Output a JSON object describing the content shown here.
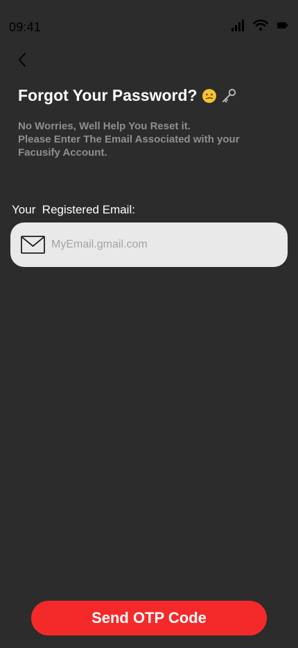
{
  "status_bar": {
    "time": "09:41",
    "icons": [
      "signal-icon",
      "wifi-icon",
      "battery-icon"
    ]
  },
  "header": {
    "back_icon": "chevron-left-icon",
    "title": "Forgot Your Password?",
    "title_emojis": [
      "confused-face-emoji",
      "key-emoji"
    ]
  },
  "subtitle": {
    "line1": "No Worries, Well Help You Reset it.",
    "line2": "Please Enter The Email Associated with your",
    "line3": "Facusify Account."
  },
  "form": {
    "email_label": "Your  Registered Email:",
    "email_icon": "mail-icon",
    "email_value": "",
    "email_placeholder": "MyEmail.gmail.com"
  },
  "actions": {
    "send_otp_label": "Send OTP Code"
  },
  "colors": {
    "background": "#2c2c2c",
    "primary_button": "#f42a2a",
    "input_background": "#e9e9e9",
    "subtitle_text": "#8f8f8f"
  }
}
